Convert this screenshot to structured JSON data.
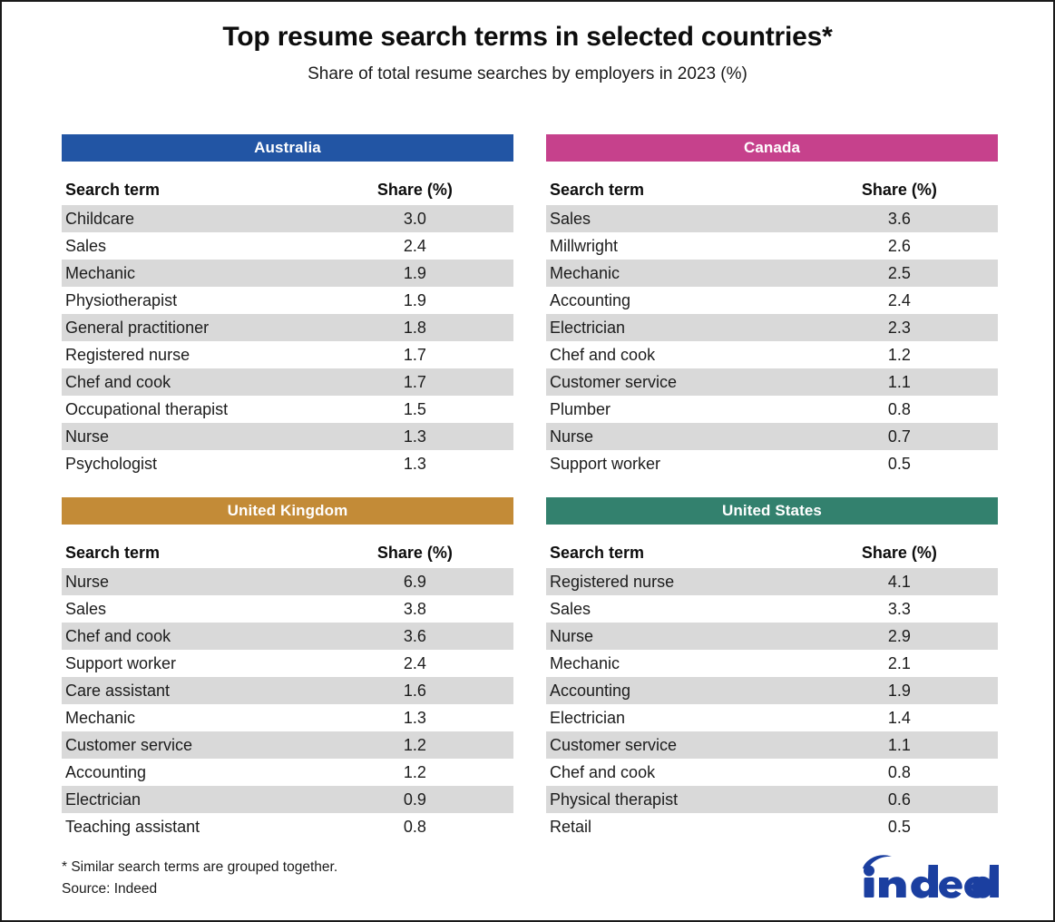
{
  "header": {
    "title": "Top resume search terms in selected countries*",
    "subtitle": "Share of total resume searches by employers in 2023 (%)"
  },
  "columns": {
    "term": "Search term",
    "share": "Share (%)"
  },
  "colors": {
    "australia": "#2255A4",
    "canada": "#C6418C",
    "united_kingdom": "#C38B37",
    "united_states": "#33816E",
    "band": "#D9D9D9",
    "logo_blue": "#1B3FA0"
  },
  "panels": [
    {
      "name": "Australia",
      "color_key": "australia",
      "rows": [
        {
          "term": "Childcare",
          "share": "3.0"
        },
        {
          "term": "Sales",
          "share": "2.4"
        },
        {
          "term": "Mechanic",
          "share": "1.9"
        },
        {
          "term": "Physiotherapist",
          "share": "1.9"
        },
        {
          "term": "General practitioner",
          "share": "1.8"
        },
        {
          "term": "Registered nurse",
          "share": "1.7"
        },
        {
          "term": "Chef and cook",
          "share": "1.7"
        },
        {
          "term": "Occupational therapist",
          "share": "1.5"
        },
        {
          "term": "Nurse",
          "share": "1.3"
        },
        {
          "term": "Psychologist",
          "share": "1.3"
        }
      ]
    },
    {
      "name": "Canada",
      "color_key": "canada",
      "rows": [
        {
          "term": "Sales",
          "share": "3.6"
        },
        {
          "term": "Millwright",
          "share": "2.6"
        },
        {
          "term": "Mechanic",
          "share": "2.5"
        },
        {
          "term": "Accounting",
          "share": "2.4"
        },
        {
          "term": "Electrician",
          "share": "2.3"
        },
        {
          "term": "Chef and cook",
          "share": "1.2"
        },
        {
          "term": "Customer service",
          "share": "1.1"
        },
        {
          "term": "Plumber",
          "share": "0.8"
        },
        {
          "term": "Nurse",
          "share": "0.7"
        },
        {
          "term": "Support worker",
          "share": "0.5"
        }
      ]
    },
    {
      "name": "United Kingdom",
      "color_key": "united_kingdom",
      "rows": [
        {
          "term": "Nurse",
          "share": "6.9"
        },
        {
          "term": "Sales",
          "share": "3.8"
        },
        {
          "term": "Chef and cook",
          "share": "3.6"
        },
        {
          "term": "Support worker",
          "share": "2.4"
        },
        {
          "term": "Care assistant",
          "share": "1.6"
        },
        {
          "term": "Mechanic",
          "share": "1.3"
        },
        {
          "term": "Customer service",
          "share": "1.2"
        },
        {
          "term": "Accounting",
          "share": "1.2"
        },
        {
          "term": "Electrician",
          "share": "0.9"
        },
        {
          "term": "Teaching assistant",
          "share": "0.8"
        }
      ]
    },
    {
      "name": "United States",
      "color_key": "united_states",
      "rows": [
        {
          "term": "Registered nurse",
          "share": "4.1"
        },
        {
          "term": "Sales",
          "share": "3.3"
        },
        {
          "term": "Nurse",
          "share": "2.9"
        },
        {
          "term": "Mechanic",
          "share": "2.1"
        },
        {
          "term": "Accounting",
          "share": "1.9"
        },
        {
          "term": "Electrician",
          "share": "1.4"
        },
        {
          "term": "Customer service",
          "share": "1.1"
        },
        {
          "term": "Chef and cook",
          "share": "0.8"
        },
        {
          "term": "Physical therapist",
          "share": "0.6"
        },
        {
          "term": "Retail",
          "share": "0.5"
        }
      ]
    }
  ],
  "footer": {
    "footnote": "* Similar search terms are grouped together.",
    "source": "Source: Indeed",
    "logo_text": "indeed"
  },
  "chart_data": {
    "type": "table",
    "title": "Top resume search terms in selected countries*",
    "subtitle": "Share of total resume searches by employers in 2023 (%)",
    "xlabel": "",
    "ylabel": "Share of total resume searches (%)",
    "columns": [
      "Search term",
      "Share (%)"
    ],
    "series": [
      {
        "name": "Australia",
        "categories": [
          "Childcare",
          "Sales",
          "Mechanic",
          "Physiotherapist",
          "General practitioner",
          "Registered nurse",
          "Chef and cook",
          "Occupational therapist",
          "Nurse",
          "Psychologist"
        ],
        "values": [
          3.0,
          2.4,
          1.9,
          1.9,
          1.8,
          1.7,
          1.7,
          1.5,
          1.3,
          1.3
        ]
      },
      {
        "name": "Canada",
        "categories": [
          "Sales",
          "Millwright",
          "Mechanic",
          "Accounting",
          "Electrician",
          "Chef and cook",
          "Customer service",
          "Plumber",
          "Nurse",
          "Support worker"
        ],
        "values": [
          3.6,
          2.6,
          2.5,
          2.4,
          2.3,
          1.2,
          1.1,
          0.8,
          0.7,
          0.5
        ]
      },
      {
        "name": "United Kingdom",
        "categories": [
          "Nurse",
          "Sales",
          "Chef and cook",
          "Support worker",
          "Care assistant",
          "Mechanic",
          "Customer service",
          "Accounting",
          "Electrician",
          "Teaching assistant"
        ],
        "values": [
          6.9,
          3.8,
          3.6,
          2.4,
          1.6,
          1.3,
          1.2,
          1.2,
          0.9,
          0.8
        ]
      },
      {
        "name": "United States",
        "categories": [
          "Registered nurse",
          "Sales",
          "Nurse",
          "Mechanic",
          "Accounting",
          "Electrician",
          "Customer service",
          "Chef and cook",
          "Physical therapist",
          "Retail"
        ],
        "values": [
          4.1,
          3.3,
          2.9,
          2.1,
          1.9,
          1.4,
          1.1,
          0.8,
          0.6,
          0.5
        ]
      }
    ],
    "annotations": [
      "* Similar search terms are grouped together.",
      "Source: Indeed"
    ],
    "grid": false,
    "legend": "none"
  }
}
